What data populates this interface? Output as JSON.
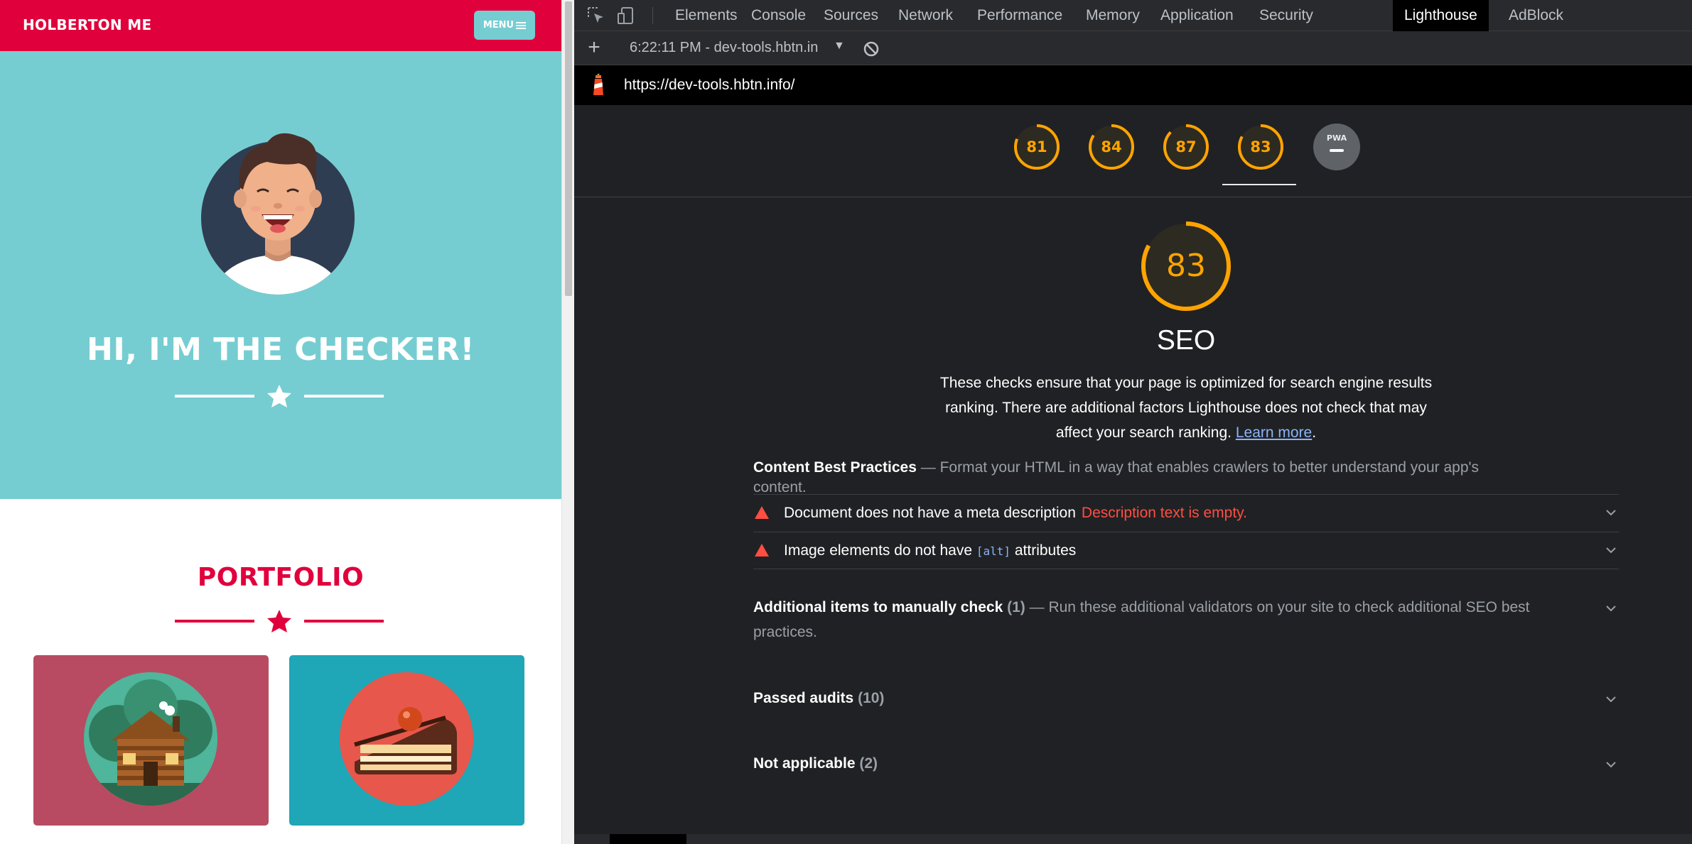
{
  "site": {
    "brand": "HOLBERTON ME",
    "menu_label": "MENU",
    "hero_title": "HI, I'M THE CHECKER!",
    "portfolio_title": "PORTFOLIO",
    "colors": {
      "brand_red": "#e0003c",
      "hero_teal": "#76cdd1",
      "card_rose": "#b84b61",
      "card_teal": "#1fa6b7"
    },
    "cards": [
      {
        "icon": "log-cabin-icon"
      },
      {
        "icon": "cake-slice-icon"
      }
    ]
  },
  "devtools": {
    "tabs": [
      "Elements",
      "Console",
      "Sources",
      "Network",
      "Performance",
      "Memory",
      "Application",
      "Security",
      "Lighthouse",
      "AdBlock"
    ],
    "active_tab": "Lighthouse",
    "report_select": "6:22:11 PM - dev-tools.hbtn.in",
    "url": "https://dev-tools.hbtn.info/",
    "scores": [
      "81",
      "84",
      "87",
      "83"
    ],
    "score_values": [
      81,
      84,
      87,
      83
    ],
    "pwa_label": "PWA",
    "active_category": {
      "score": "83",
      "score_value": 83,
      "title": "SEO",
      "description": "These checks ensure that your page is optimized for search engine results ranking. There are additional factors Lighthouse does not check that may affect your search ranking.",
      "learn_more": "Learn more",
      "desc_end": "."
    },
    "group": {
      "title": "Content Best Practices",
      "separator": "—",
      "description": "Format your HTML in a way that enables crawlers to better understand your app's content."
    },
    "audits": [
      {
        "title": "Document does not have a meta description",
        "error": "Description text is empty."
      },
      {
        "title_before": "Image elements do not have",
        "code": "[alt]",
        "title_after": "attributes"
      }
    ],
    "manual": {
      "title": "Additional items to manually check",
      "count": "(1)",
      "separator": "—",
      "description": "Run these additional validators on your site to check additional SEO best practices."
    },
    "passed": {
      "title": "Passed audits",
      "count": "(10)"
    },
    "not_applicable": {
      "title": "Not applicable",
      "count": "(2)"
    },
    "colors": {
      "average": "#ffa400",
      "fail": "#ff4e42",
      "link": "#8ab4f8"
    }
  }
}
